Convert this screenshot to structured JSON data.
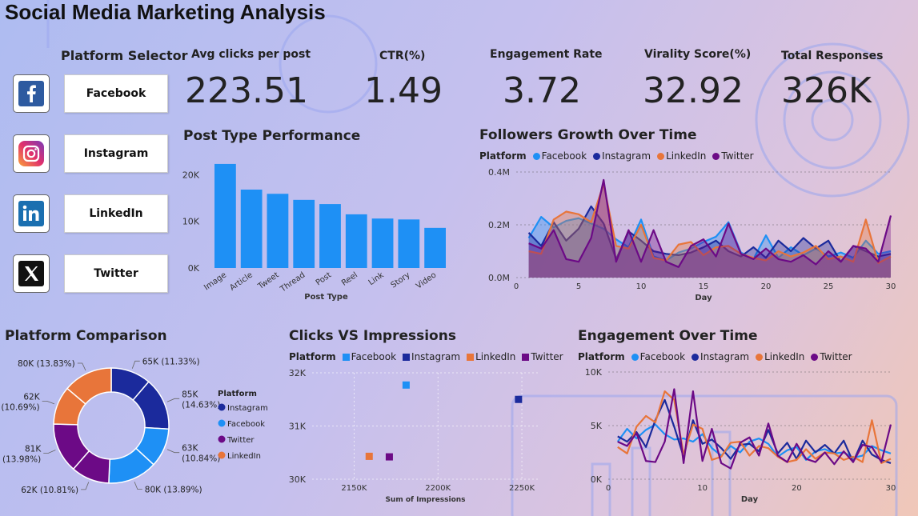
{
  "title": "Social Media Marketing Analysis",
  "selector": {
    "title": "Platform Selector",
    "items": [
      {
        "label": "Facebook",
        "icon": "facebook-icon"
      },
      {
        "label": "Instagram",
        "icon": "instagram-icon"
      },
      {
        "label": "LinkedIn",
        "icon": "linkedin-icon"
      },
      {
        "label": "Twitter",
        "icon": "x-twitter-icon"
      }
    ]
  },
  "kpis": [
    {
      "label": "Avg clicks per post",
      "value": "223.51"
    },
    {
      "label": "CTR(%)",
      "value": "1.49"
    },
    {
      "label": "Engagement Rate",
      "value": "3.72"
    },
    {
      "label": "Virality Score(%)",
      "value": "32.92"
    },
    {
      "label": "Total Responses",
      "value": "326K"
    }
  ],
  "colors": {
    "Facebook": "#1e90f5",
    "Instagram": "#1b2a9c",
    "LinkedIn": "#e8753a",
    "Twitter": "#6c0a86"
  },
  "chart_data": [
    {
      "id": "post-type",
      "type": "bar",
      "title": "Post Type Performance",
      "xlabel": "Post Type",
      "ylabel": "",
      "categories": [
        "Image",
        "Article",
        "Tweet",
        "Thread",
        "Post",
        "Reel",
        "Link",
        "Story",
        "Video"
      ],
      "values": [
        22300,
        16800,
        15900,
        14600,
        13700,
        11500,
        10600,
        10400,
        8600
      ],
      "yticks": [
        0,
        10000,
        20000
      ],
      "ytick_labels": [
        "0K",
        "10K",
        "20K"
      ],
      "ylim": [
        0,
        24000
      ],
      "color": "#1e90f5"
    },
    {
      "id": "followers",
      "type": "area",
      "title": "Followers Growth Over Time",
      "xlabel": "Day",
      "legend_title": "Platform",
      "x": [
        1,
        2,
        3,
        4,
        5,
        6,
        7,
        8,
        9,
        10,
        11,
        12,
        13,
        14,
        15,
        16,
        17,
        18,
        19,
        20,
        21,
        22,
        23,
        24,
        25,
        26,
        27,
        28,
        29,
        30
      ],
      "xticks": [
        0,
        5,
        10,
        15,
        20,
        25,
        30
      ],
      "yticks": [
        0,
        200000,
        400000
      ],
      "ytick_labels": [
        "0.0M",
        "0.2M",
        "0.4M"
      ],
      "ylim": [
        0,
        400000
      ],
      "series": [
        {
          "name": "Facebook",
          "values": [
            150000,
            230000,
            190000,
            215000,
            225000,
            205000,
            185000,
            145000,
            115000,
            220000,
            80000,
            65000,
            95000,
            110000,
            135000,
            155000,
            210000,
            95000,
            70000,
            160000,
            75000,
            115000,
            85000,
            110000,
            80000,
            95000,
            75000,
            140000,
            90000,
            100000
          ]
        },
        {
          "name": "Instagram",
          "values": [
            170000,
            120000,
            210000,
            140000,
            185000,
            270000,
            205000,
            70000,
            175000,
            140000,
            100000,
            90000,
            85000,
            95000,
            115000,
            140000,
            100000,
            80000,
            115000,
            75000,
            140000,
            100000,
            150000,
            110000,
            140000,
            60000,
            120000,
            100000,
            80000,
            90000
          ]
        },
        {
          "name": "LinkedIn",
          "values": [
            100000,
            90000,
            220000,
            250000,
            240000,
            210000,
            355000,
            120000,
            110000,
            200000,
            75000,
            65000,
            125000,
            135000,
            85000,
            115000,
            120000,
            90000,
            75000,
            65000,
            100000,
            80000,
            95000,
            120000,
            70000,
            80000,
            60000,
            220000,
            55000,
            80000
          ]
        },
        {
          "name": "Twitter",
          "values": [
            130000,
            110000,
            180000,
            70000,
            60000,
            150000,
            370000,
            60000,
            180000,
            60000,
            180000,
            60000,
            40000,
            120000,
            145000,
            80000,
            205000,
            90000,
            70000,
            110000,
            70000,
            60000,
            85000,
            50000,
            100000,
            60000,
            120000,
            110000,
            60000,
            235000
          ]
        }
      ]
    },
    {
      "id": "platform-comparison",
      "type": "pie",
      "title": "Platform Comparison",
      "legend_title": "Platform",
      "legend_items": [
        "Instagram",
        "Facebook",
        "Twitter",
        "LinkedIn"
      ],
      "slices": [
        {
          "name": "Instagram",
          "value": 65000,
          "label": "65K (11.33%)"
        },
        {
          "name": "Instagram",
          "value": 85000,
          "label": "85K (14.63%)"
        },
        {
          "name": "Facebook",
          "value": 63000,
          "label": "63K (10.84%)"
        },
        {
          "name": "Facebook",
          "value": 80000,
          "label": "80K (13.89%)"
        },
        {
          "name": "Twitter",
          "value": 62000,
          "label": "62K (10.81%)"
        },
        {
          "name": "Twitter",
          "value": 81000,
          "label": "81K (13.98%)"
        },
        {
          "name": "LinkedIn",
          "value": 62000,
          "label": "62K (10.69%)"
        },
        {
          "name": "LinkedIn",
          "value": 80000,
          "label": "80K (13.83%)"
        }
      ]
    },
    {
      "id": "clicks-impressions",
      "type": "scatter",
      "title": "Clicks VS Impressions",
      "xlabel": "Sum of Impressions",
      "legend_title": "Platform",
      "xlim": [
        2125000,
        2260000
      ],
      "ylim": [
        30000,
        32000
      ],
      "xticks": [
        2150000,
        2200000,
        2250000
      ],
      "xtick_labels": [
        "2150K",
        "2200K",
        "2250K"
      ],
      "yticks": [
        30000,
        31000,
        32000
      ],
      "ytick_labels": [
        "30K",
        "31K",
        "32K"
      ],
      "points": [
        {
          "name": "Facebook",
          "x": 2181000,
          "y": 31770
        },
        {
          "name": "Instagram",
          "x": 2248000,
          "y": 31500
        },
        {
          "name": "LinkedIn",
          "x": 2159000,
          "y": 30430
        },
        {
          "name": "Twitter",
          "x": 2171000,
          "y": 30420
        }
      ]
    },
    {
      "id": "engagement",
      "type": "line",
      "title": "Engagement Over Time",
      "xlabel": "Day",
      "legend_title": "Platform",
      "x": [
        1,
        2,
        3,
        4,
        5,
        6,
        7,
        8,
        9,
        10,
        11,
        12,
        13,
        14,
        15,
        16,
        17,
        18,
        19,
        20,
        21,
        22,
        23,
        24,
        25,
        26,
        27,
        28,
        29,
        30
      ],
      "xticks": [
        0,
        10,
        20,
        30
      ],
      "yticks": [
        0,
        5000,
        10000
      ],
      "ytick_labels": [
        "0K",
        "5K",
        "10K"
      ],
      "ylim": [
        0,
        10000
      ],
      "series": [
        {
          "name": "Facebook",
          "values": [
            3500,
            4700,
            3800,
            4600,
            5100,
            4200,
            3700,
            3800,
            3500,
            4200,
            2900,
            2200,
            3100,
            2500,
            3500,
            3800,
            3300,
            2100,
            2700,
            3000,
            1800,
            2600,
            2800,
            2400,
            2500,
            2000,
            2200,
            3100,
            2700,
            2400
          ]
        },
        {
          "name": "Instagram",
          "values": [
            4000,
            3500,
            4400,
            3000,
            5500,
            7400,
            4900,
            2100,
            5500,
            3300,
            3700,
            2900,
            1900,
            3200,
            3300,
            2600,
            4600,
            2400,
            3400,
            1900,
            3600,
            2500,
            3200,
            2400,
            3600,
            1600,
            3600,
            2300,
            1800,
            1500
          ]
        },
        {
          "name": "LinkedIn",
          "values": [
            3000,
            2400,
            4900,
            5900,
            5300,
            8200,
            7400,
            2300,
            5100,
            4700,
            1800,
            2100,
            3400,
            3500,
            2200,
            3100,
            2900,
            2100,
            1600,
            1800,
            2800,
            1900,
            2500,
            2400,
            1800,
            2100,
            1600,
            5500,
            1500,
            1900
          ]
        },
        {
          "name": "Twitter",
          "values": [
            3500,
            3100,
            4300,
            1700,
            1600,
            3500,
            8400,
            1500,
            8200,
            1700,
            4700,
            1500,
            1000,
            3400,
            3900,
            2200,
            5200,
            2200,
            1600,
            3300,
            1900,
            1600,
            2500,
            1400,
            2600,
            1600,
            3200,
            3000,
            1600,
            5100
          ]
        }
      ]
    }
  ]
}
